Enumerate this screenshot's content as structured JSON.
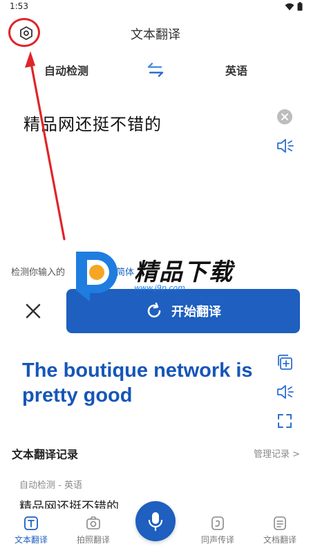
{
  "status_bar": {
    "time": "1:53"
  },
  "header": {
    "title": "文本翻译",
    "settings_icon": "settings-icon"
  },
  "languages": {
    "source": "自动检测",
    "target": "英语",
    "swap_icon": "swap-icon"
  },
  "input": {
    "text": "精品网还挺不错的"
  },
  "detect_hint": {
    "prefix": "检测你输入的",
    "link": "简体"
  },
  "actions": {
    "translate_label": "开始翻译"
  },
  "result": {
    "text": "The boutique network is pretty good"
  },
  "history": {
    "title": "文本翻译记录",
    "manage_label": "管理记录 >",
    "items": [
      {
        "lang": "自动检测 - 英语",
        "text": "精品网还挺不错的"
      }
    ]
  },
  "bottom_nav": {
    "items": [
      {
        "label": "文本翻译",
        "icon": "text-translate-icon",
        "active": true
      },
      {
        "label": "拍照翻译",
        "icon": "camera-icon",
        "active": false
      },
      {
        "label": "同声传译",
        "icon": "simultaneous-icon",
        "active": false
      },
      {
        "label": "文档翻译",
        "icon": "document-icon",
        "active": false
      }
    ]
  },
  "watermark": {
    "text": "精品下载",
    "url": "www.j9p.com"
  },
  "colors": {
    "primary": "#1e5fbf",
    "result": "#1656b8",
    "annotation": "#e0242a"
  }
}
